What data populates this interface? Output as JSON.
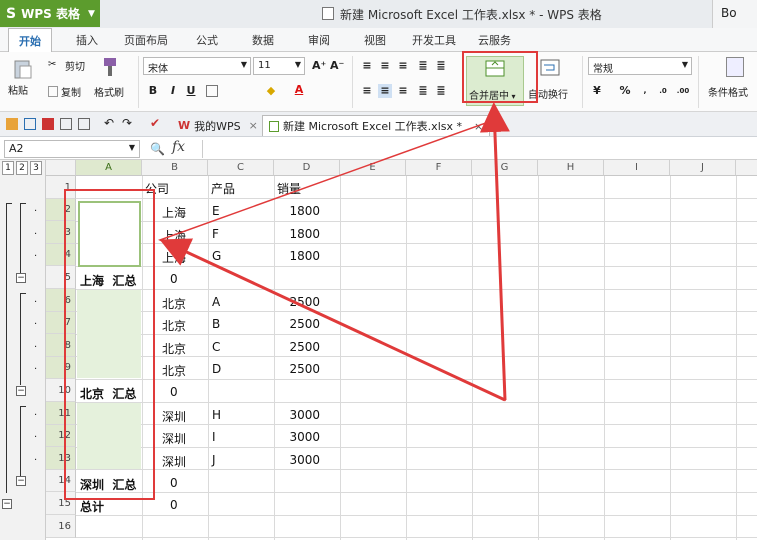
{
  "title_bar": {
    "app_name": "WPS 表格",
    "window_title": "新建 Microsoft Excel 工作表.xlsx * - WPS 表格",
    "right_tab_text": "Bo"
  },
  "ribbon_tabs": [
    "开始",
    "插入",
    "页面布局",
    "公式",
    "数据",
    "审阅",
    "视图",
    "开发工具",
    "云服务"
  ],
  "ribbon": {
    "paste": "粘贴",
    "cut": "剪切",
    "copy": "复制",
    "format_painter": "格式刷",
    "font_name": "宋体",
    "font_size": "11",
    "merge_center": "合并居中",
    "wrap_text": "自动换行",
    "number_format": "常规",
    "percent": "%",
    "cond_format": "条件格式"
  },
  "quick_bar": {
    "tab_mywps": "我的WPS",
    "tab_doc": "新建 Microsoft Excel 工作表.xlsx *"
  },
  "formula_bar": {
    "name_box": "A2",
    "fx": "fx",
    "value": ""
  },
  "outline_levels": [
    "1",
    "2",
    "3"
  ],
  "columns": [
    "A",
    "B",
    "C",
    "D",
    "E",
    "F",
    "G",
    "H",
    "I",
    "J"
  ],
  "rows": [
    "1",
    "2",
    "3",
    "4",
    "5",
    "6",
    "7",
    "8",
    "9",
    "10",
    "11",
    "12",
    "13",
    "14",
    "15",
    "16"
  ],
  "cells": {
    "b1": "公司",
    "c1": "产品",
    "d1": "销量",
    "b2": "上海",
    "c2": "E",
    "d2": "1800",
    "b3": "上海",
    "c3": "F",
    "d3": "1800",
    "b4": "上海",
    "c4": "G",
    "d4": "1800",
    "a5": "上海  汇总",
    "b5": "0",
    "b6": "北京",
    "c6": "A",
    "d6": "2500",
    "b7": "北京",
    "c7": "B",
    "d7": "2500",
    "b8": "北京",
    "c8": "C",
    "d8": "2500",
    "b9": "北京",
    "c9": "D",
    "d9": "2500",
    "a10": "北京  汇总",
    "b10": "0",
    "b11": "深圳",
    "c11": "H",
    "d11": "3000",
    "b12": "深圳",
    "c12": "I",
    "d12": "3000",
    "b13": "深圳",
    "c13": "J",
    "d13": "3000",
    "a14": "深圳  汇总",
    "b14": "0",
    "a15": "总计",
    "b15": "0"
  },
  "colors": {
    "accent": "#5c9c2d",
    "annotation": "#e03a3a",
    "selection": "#e5f1dc"
  }
}
